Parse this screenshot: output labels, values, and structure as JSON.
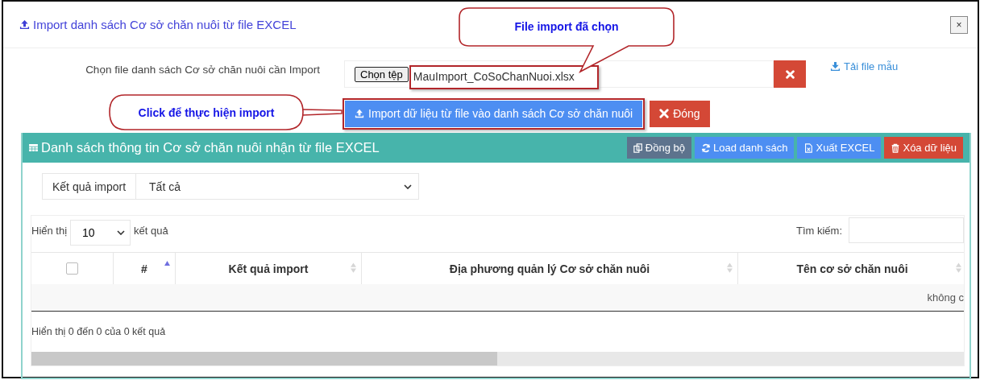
{
  "dialog": {
    "title": "Import danh sách Cơ sở chăn nuôi từ file EXCEL",
    "close": "×"
  },
  "form": {
    "label": "Chọn file danh sách Cơ sở chăn nuôi cần Import",
    "file_button": "Chọn tệp",
    "file_name": "MauImport_CoSoChanNuoi.xlsx",
    "template_link": "Tải file mẫu"
  },
  "actions": [
    {
      "label": "Import dữ liệu từ file vào danh sách Cơ sở chăn nuôi",
      "kind": "import"
    },
    {
      "label": "Đóng",
      "kind": "close"
    }
  ],
  "panel": {
    "title": "Danh sách thông tin Cơ sở chăn nuôi nhận từ file EXCEL",
    "buttons": [
      {
        "label": "Đồng bộ",
        "kind": "sync"
      },
      {
        "label": "Load danh sách",
        "kind": "reload"
      },
      {
        "label": "Xuất EXCEL",
        "kind": "export"
      },
      {
        "label": "Xóa dữ liệu",
        "kind": "delete"
      }
    ]
  },
  "filter": {
    "label": "Kết quả import",
    "value": "Tất cả"
  },
  "table": {
    "length_before": "Hiển thị",
    "page_size": "10",
    "length_after": "kết quả",
    "search_label": "Tìm kiếm:",
    "columns": [
      {
        "kind": "checkbox",
        "checked": false
      },
      {
        "kind": "text",
        "label": "#",
        "sorted": true
      },
      {
        "kind": "text",
        "label": "Kết quả import",
        "sorted": false
      },
      {
        "kind": "text",
        "label": "Địa phương quản lý Cơ sở chăn nuôi",
        "sorted": false
      },
      {
        "kind": "text",
        "label": "Tên cơ sở chăn nuôi",
        "sorted": false
      }
    ],
    "empty_message": "không c",
    "info": "Hiển thị 0 đến 0 của 0 kết quả"
  },
  "callouts": [
    {
      "text": "File import đã chọn",
      "kind": "file"
    },
    {
      "text": "Click để thực hiện import",
      "kind": "import"
    }
  ]
}
